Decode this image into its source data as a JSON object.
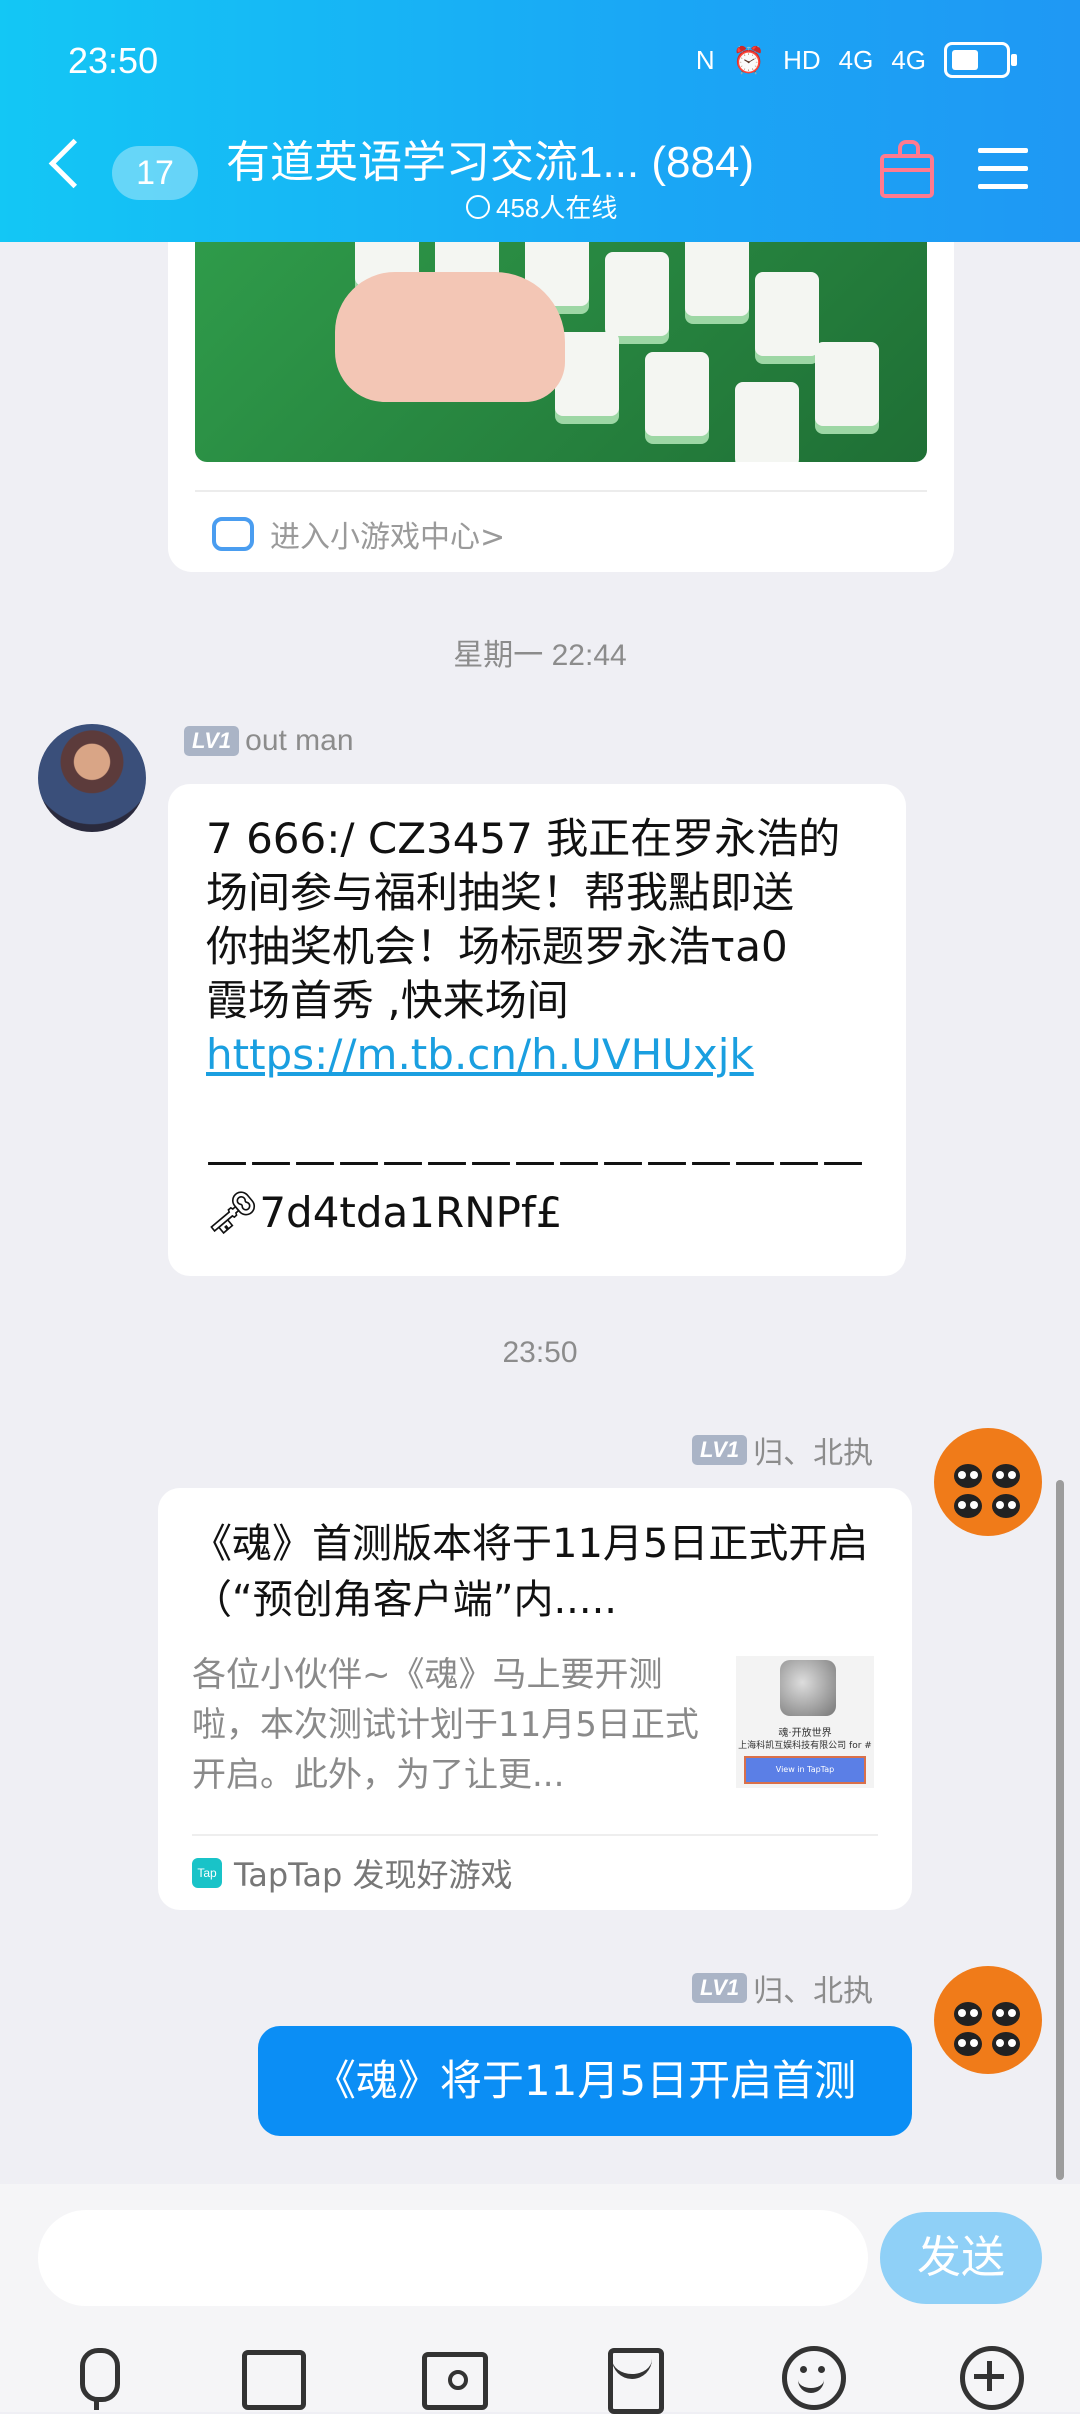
{
  "status_bar": {
    "time": "23:50",
    "icons": [
      "nfc-icon",
      "alarm-icon",
      "hd-icon",
      "4g-signal-icon",
      "4g-signal-icon",
      "battery-icon"
    ],
    "network_a": "4G",
    "network_b": "4G",
    "hd": "HD"
  },
  "header": {
    "unread_count": "17",
    "title": "有道英语学习交流1... (884)",
    "online": "458人在线"
  },
  "game_card": {
    "link_text": "进入小游戏中心>"
  },
  "messages": [
    {
      "timestamp": "星期一 22:44",
      "sender": "out man",
      "level": "LV1",
      "text_lines": [
        "7 666:/ CZ3457 我正在罗永浩的",
        "场间参与福利抽奖！帮我點即送",
        "你抽奖机会！场标题罗永浩τa0",
        "霞场首秀 ,快来场间"
      ],
      "link": "https://m.tb.cn/h.UVHUxjk",
      "divider": "———————————————",
      "key_text": "🗝7d4tda1RNPf£"
    },
    {
      "timestamp": "23:50",
      "sender": "归、北执",
      "level": "LV1",
      "share": {
        "title": "《魂》首测版本将于11月5日正式开启（“预创角客户端”内.....",
        "desc": "各位小伙伴~《魂》马上要开测啦，本次测试计划于11月5日正式开启。此外，为了让更...",
        "thumb_line1": "魂·开放世界",
        "thumb_line2": "上海科凯互娱科技有限公司 for #",
        "thumb_button": "View in TapTap",
        "source_badge": "Tap",
        "source": "TapTap 发现好游戏"
      }
    },
    {
      "sender": "归、北执",
      "level": "LV1",
      "text": "《魂》将于11月5日开启首测"
    }
  ],
  "input_bar": {
    "placeholder": "",
    "send_label": "发送"
  },
  "colors": {
    "header_gradient_start": "#13c7f5",
    "header_gradient_end": "#1f98f4",
    "my_bubble": "#0b8ef5",
    "link": "#1a9fe0",
    "send_button": "#8fd0f7"
  }
}
